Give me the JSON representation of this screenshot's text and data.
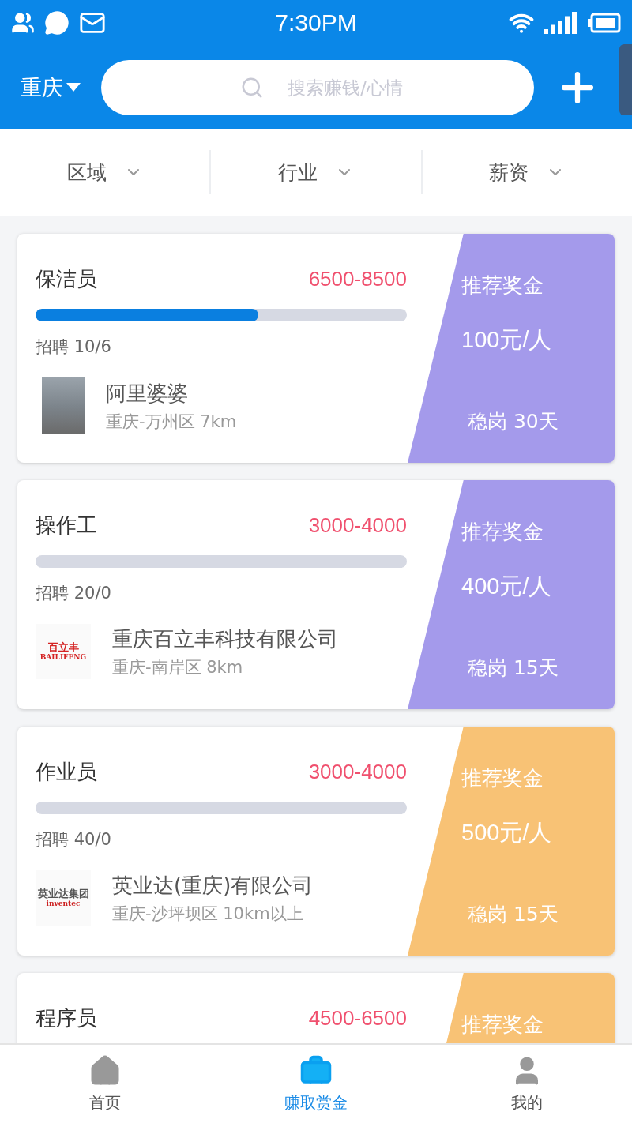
{
  "status_bar": {
    "time": "7:30PM"
  },
  "header": {
    "city": "重庆",
    "search": {
      "placeholder": "搜索赚钱/心情"
    }
  },
  "filters": [
    {
      "label": "区域"
    },
    {
      "label": "行业"
    },
    {
      "label": "薪资"
    }
  ],
  "jobs": [
    {
      "title": "保洁员",
      "salary": "6500-8500",
      "level": 0.6,
      "hiring": "招聘 10/6",
      "company": {
        "kind": "photo",
        "name": "阿里婆婆",
        "location": "重庆-万州区 7km"
      },
      "bonus": {
        "label": "推荐奖金",
        "amount": "100元/人",
        "term": "稳岗 30天",
        "color": "#a49aeb"
      }
    },
    {
      "title": "操作工",
      "salary": "3000-4000",
      "level": 0,
      "hiring": "招聘 20/0",
      "company": {
        "kind": "logo",
        "logo_text": [
          "百立丰",
          "BAILIFENG"
        ],
        "name": "重庆百立丰科技有限公司",
        "location": "重庆-南岸区 8km"
      },
      "bonus": {
        "label": "推荐奖金",
        "amount": "400元/人",
        "term": "稳岗 15天",
        "color": "#a49aeb"
      }
    },
    {
      "title": "作业员",
      "salary": "3000-4000",
      "level": 0,
      "hiring": "招聘 40/0",
      "company": {
        "kind": "logo",
        "logo_text": [
          "英业达集团",
          "inventec"
        ],
        "name": "英业达(重庆)有限公司",
        "location": "重庆-沙坪坝区 10km以上"
      },
      "bonus": {
        "label": "推荐奖金",
        "amount": "500元/人",
        "term": "稳岗 15天",
        "color": "#f8c275"
      }
    },
    {
      "title": "程序员",
      "salary": "4500-6500",
      "bonus": {
        "label": "推荐奖金",
        "color": "#f8c275"
      }
    }
  ],
  "tab_bar": [
    {
      "label": "首页",
      "kind": "home",
      "selected": false
    },
    {
      "label": "赚取赏金",
      "kind": "briefcase",
      "selected": true
    },
    {
      "label": "我的",
      "kind": "user",
      "selected": false
    }
  ]
}
